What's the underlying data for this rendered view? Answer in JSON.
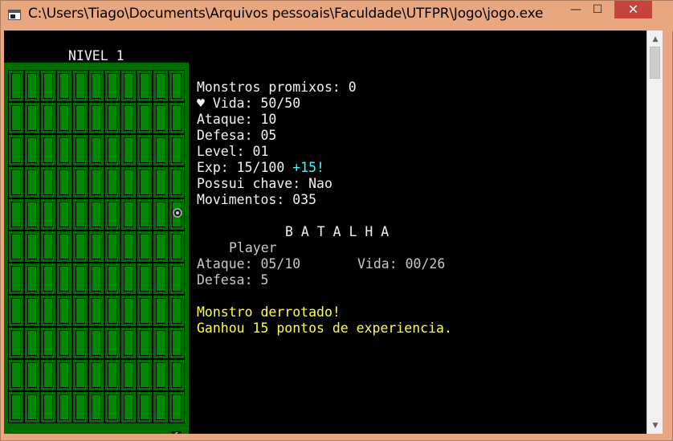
{
  "window": {
    "title": "C:\\Users\\Tiago\\Documents\\Arquivos pessoais\\Faculdade\\UTFPR\\Jogo\\jogo.exe",
    "minimize": "—",
    "maximize": "☐",
    "close": "✕"
  },
  "game": {
    "level_title": "NIVEL 1",
    "stats": {
      "monsters": "Monstros promixos: 0",
      "heart": "♥",
      "life": " Vida: 50/50",
      "attack": "Ataque: 10",
      "defense": "Defesa: 05",
      "level": "Level: 01",
      "exp": "Exp: 15/100 ",
      "exp_gain": "+15!",
      "key": "Possui chave: Nao",
      "moves": "Movimentos: 035"
    },
    "battle": {
      "title": "B A T A L H A",
      "player_label": "Player",
      "attack": "Ataque: 05/10",
      "life": "Vida: 00/26",
      "defense": "Defesa: 5"
    },
    "messages": {
      "defeated": "Monstro derrotado!",
      "gained": "Ganhou 15 pontos de experiencia."
    },
    "colors": {
      "background": "#000000",
      "text": "#f2f2f2",
      "highlight_yellow": "#ffff44",
      "highlight_cyan": "#33ffff",
      "map_green": "#008800"
    }
  }
}
